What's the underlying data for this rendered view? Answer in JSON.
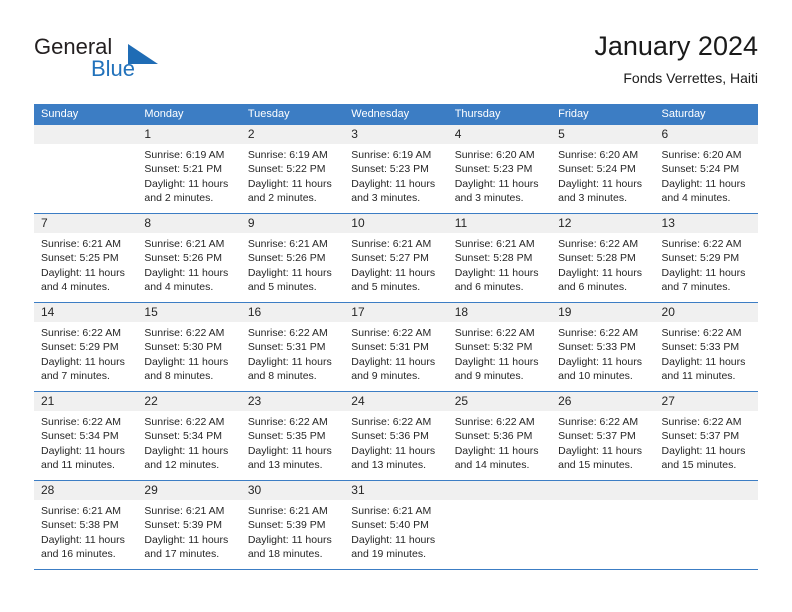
{
  "brand": {
    "name_part1": "General",
    "name_part2": "Blue",
    "triangle_color": "#1f6cb5",
    "blue_color": "#2272bb"
  },
  "header": {
    "title": "January 2024",
    "subtitle": "Fonds Verrettes, Haiti"
  },
  "theme": {
    "header_bg": "#3c7dc4",
    "day_header_bg": "#f0f0f0",
    "text_color": "#262626"
  },
  "weekdays": [
    {
      "label": "Sunday"
    },
    {
      "label": "Monday"
    },
    {
      "label": "Tuesday"
    },
    {
      "label": "Wednesday"
    },
    {
      "label": "Thursday"
    },
    {
      "label": "Friday"
    },
    {
      "label": "Saturday"
    }
  ],
  "weeks": [
    [
      {
        "day": "",
        "lines": []
      },
      {
        "day": "1",
        "lines": [
          "Sunrise: 6:19 AM",
          "Sunset: 5:21 PM",
          "Daylight: 11 hours",
          "and 2 minutes."
        ]
      },
      {
        "day": "2",
        "lines": [
          "Sunrise: 6:19 AM",
          "Sunset: 5:22 PM",
          "Daylight: 11 hours",
          "and 2 minutes."
        ]
      },
      {
        "day": "3",
        "lines": [
          "Sunrise: 6:19 AM",
          "Sunset: 5:23 PM",
          "Daylight: 11 hours",
          "and 3 minutes."
        ]
      },
      {
        "day": "4",
        "lines": [
          "Sunrise: 6:20 AM",
          "Sunset: 5:23 PM",
          "Daylight: 11 hours",
          "and 3 minutes."
        ]
      },
      {
        "day": "5",
        "lines": [
          "Sunrise: 6:20 AM",
          "Sunset: 5:24 PM",
          "Daylight: 11 hours",
          "and 3 minutes."
        ]
      },
      {
        "day": "6",
        "lines": [
          "Sunrise: 6:20 AM",
          "Sunset: 5:24 PM",
          "Daylight: 11 hours",
          "and 4 minutes."
        ]
      }
    ],
    [
      {
        "day": "7",
        "lines": [
          "Sunrise: 6:21 AM",
          "Sunset: 5:25 PM",
          "Daylight: 11 hours",
          "and 4 minutes."
        ]
      },
      {
        "day": "8",
        "lines": [
          "Sunrise: 6:21 AM",
          "Sunset: 5:26 PM",
          "Daylight: 11 hours",
          "and 4 minutes."
        ]
      },
      {
        "day": "9",
        "lines": [
          "Sunrise: 6:21 AM",
          "Sunset: 5:26 PM",
          "Daylight: 11 hours",
          "and 5 minutes."
        ]
      },
      {
        "day": "10",
        "lines": [
          "Sunrise: 6:21 AM",
          "Sunset: 5:27 PM",
          "Daylight: 11 hours",
          "and 5 minutes."
        ]
      },
      {
        "day": "11",
        "lines": [
          "Sunrise: 6:21 AM",
          "Sunset: 5:28 PM",
          "Daylight: 11 hours",
          "and 6 minutes."
        ]
      },
      {
        "day": "12",
        "lines": [
          "Sunrise: 6:22 AM",
          "Sunset: 5:28 PM",
          "Daylight: 11 hours",
          "and 6 minutes."
        ]
      },
      {
        "day": "13",
        "lines": [
          "Sunrise: 6:22 AM",
          "Sunset: 5:29 PM",
          "Daylight: 11 hours",
          "and 7 minutes."
        ]
      }
    ],
    [
      {
        "day": "14",
        "lines": [
          "Sunrise: 6:22 AM",
          "Sunset: 5:29 PM",
          "Daylight: 11 hours",
          "and 7 minutes."
        ]
      },
      {
        "day": "15",
        "lines": [
          "Sunrise: 6:22 AM",
          "Sunset: 5:30 PM",
          "Daylight: 11 hours",
          "and 8 minutes."
        ]
      },
      {
        "day": "16",
        "lines": [
          "Sunrise: 6:22 AM",
          "Sunset: 5:31 PM",
          "Daylight: 11 hours",
          "and 8 minutes."
        ]
      },
      {
        "day": "17",
        "lines": [
          "Sunrise: 6:22 AM",
          "Sunset: 5:31 PM",
          "Daylight: 11 hours",
          "and 9 minutes."
        ]
      },
      {
        "day": "18",
        "lines": [
          "Sunrise: 6:22 AM",
          "Sunset: 5:32 PM",
          "Daylight: 11 hours",
          "and 9 minutes."
        ]
      },
      {
        "day": "19",
        "lines": [
          "Sunrise: 6:22 AM",
          "Sunset: 5:33 PM",
          "Daylight: 11 hours",
          "and 10 minutes."
        ]
      },
      {
        "day": "20",
        "lines": [
          "Sunrise: 6:22 AM",
          "Sunset: 5:33 PM",
          "Daylight: 11 hours",
          "and 11 minutes."
        ]
      }
    ],
    [
      {
        "day": "21",
        "lines": [
          "Sunrise: 6:22 AM",
          "Sunset: 5:34 PM",
          "Daylight: 11 hours",
          "and 11 minutes."
        ]
      },
      {
        "day": "22",
        "lines": [
          "Sunrise: 6:22 AM",
          "Sunset: 5:34 PM",
          "Daylight: 11 hours",
          "and 12 minutes."
        ]
      },
      {
        "day": "23",
        "lines": [
          "Sunrise: 6:22 AM",
          "Sunset: 5:35 PM",
          "Daylight: 11 hours",
          "and 13 minutes."
        ]
      },
      {
        "day": "24",
        "lines": [
          "Sunrise: 6:22 AM",
          "Sunset: 5:36 PM",
          "Daylight: 11 hours",
          "and 13 minutes."
        ]
      },
      {
        "day": "25",
        "lines": [
          "Sunrise: 6:22 AM",
          "Sunset: 5:36 PM",
          "Daylight: 11 hours",
          "and 14 minutes."
        ]
      },
      {
        "day": "26",
        "lines": [
          "Sunrise: 6:22 AM",
          "Sunset: 5:37 PM",
          "Daylight: 11 hours",
          "and 15 minutes."
        ]
      },
      {
        "day": "27",
        "lines": [
          "Sunrise: 6:22 AM",
          "Sunset: 5:37 PM",
          "Daylight: 11 hours",
          "and 15 minutes."
        ]
      }
    ],
    [
      {
        "day": "28",
        "lines": [
          "Sunrise: 6:21 AM",
          "Sunset: 5:38 PM",
          "Daylight: 11 hours",
          "and 16 minutes."
        ]
      },
      {
        "day": "29",
        "lines": [
          "Sunrise: 6:21 AM",
          "Sunset: 5:39 PM",
          "Daylight: 11 hours",
          "and 17 minutes."
        ]
      },
      {
        "day": "30",
        "lines": [
          "Sunrise: 6:21 AM",
          "Sunset: 5:39 PM",
          "Daylight: 11 hours",
          "and 18 minutes."
        ]
      },
      {
        "day": "31",
        "lines": [
          "Sunrise: 6:21 AM",
          "Sunset: 5:40 PM",
          "Daylight: 11 hours",
          "and 19 minutes."
        ]
      },
      {
        "day": "",
        "lines": []
      },
      {
        "day": "",
        "lines": []
      },
      {
        "day": "",
        "lines": []
      }
    ]
  ]
}
